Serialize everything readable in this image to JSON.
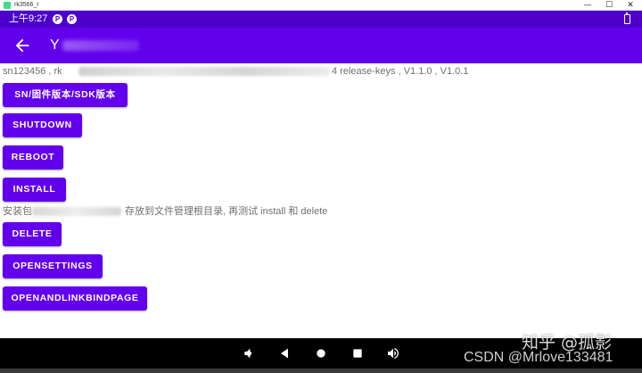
{
  "window": {
    "title": "rk3566_r",
    "minimize_glyph": "—",
    "maximize_glyph": "☐",
    "close_glyph": "✕"
  },
  "status_bar": {
    "time": "上午9:27",
    "icons": [
      "notification-p-icon",
      "notification-p-icon",
      "battery-icon"
    ],
    "icon_glyph": "P"
  },
  "app_bar": {
    "title_visible": "Y",
    "back_icon": "arrow-back-icon"
  },
  "info": {
    "line1_start": "sn123456 , rk",
    "line1_end": "4 release-keys , V1.1.0 , V1.0.1",
    "line2_start": "安装包",
    "line2_end": "存放到文件管理根目录, 再测试 install 和 delete"
  },
  "buttons": {
    "sn": "SN/固件版本/SDK版本",
    "shutdown": "SHUTDOWN",
    "reboot": "REBOOT",
    "install": "INSTALL",
    "delete": "DELETE",
    "opensettings": "OPENSETTINGS",
    "openandlinkbindpage": "OPENANDLINKBINDPAGE"
  },
  "nav_bar": {
    "icons": [
      "volume-down-icon",
      "back-triangle-icon",
      "home-circle-icon",
      "recents-square-icon",
      "volume-up-icon"
    ]
  },
  "watermark": {
    "zhihu": "知乎 @孤影",
    "csdn": "CSDN @Mrlove133481"
  },
  "colors": {
    "status_bar": "#4d00cc",
    "app_bar": "#6200ee",
    "button": "#6200ee",
    "button_text": "#ffffff",
    "info_text": "#6f6f6f",
    "nav_bar": "#000000"
  }
}
